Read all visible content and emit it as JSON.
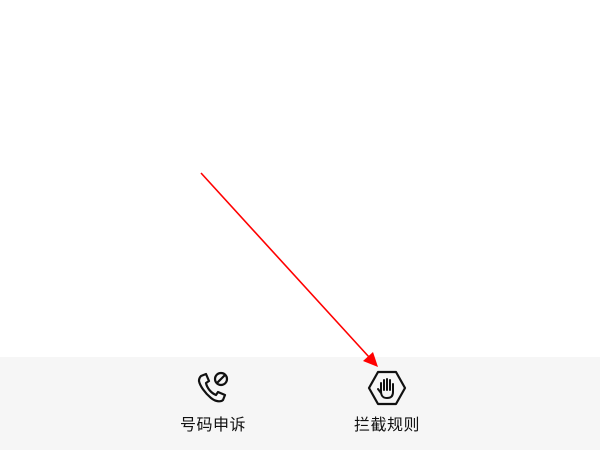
{
  "bottom_nav": {
    "items": [
      {
        "label": "号码申诉",
        "icon": "phone-block-icon"
      },
      {
        "label": "拦截规则",
        "icon": "hand-stop-icon"
      }
    ]
  },
  "annotation": {
    "color": "#ff0000"
  }
}
